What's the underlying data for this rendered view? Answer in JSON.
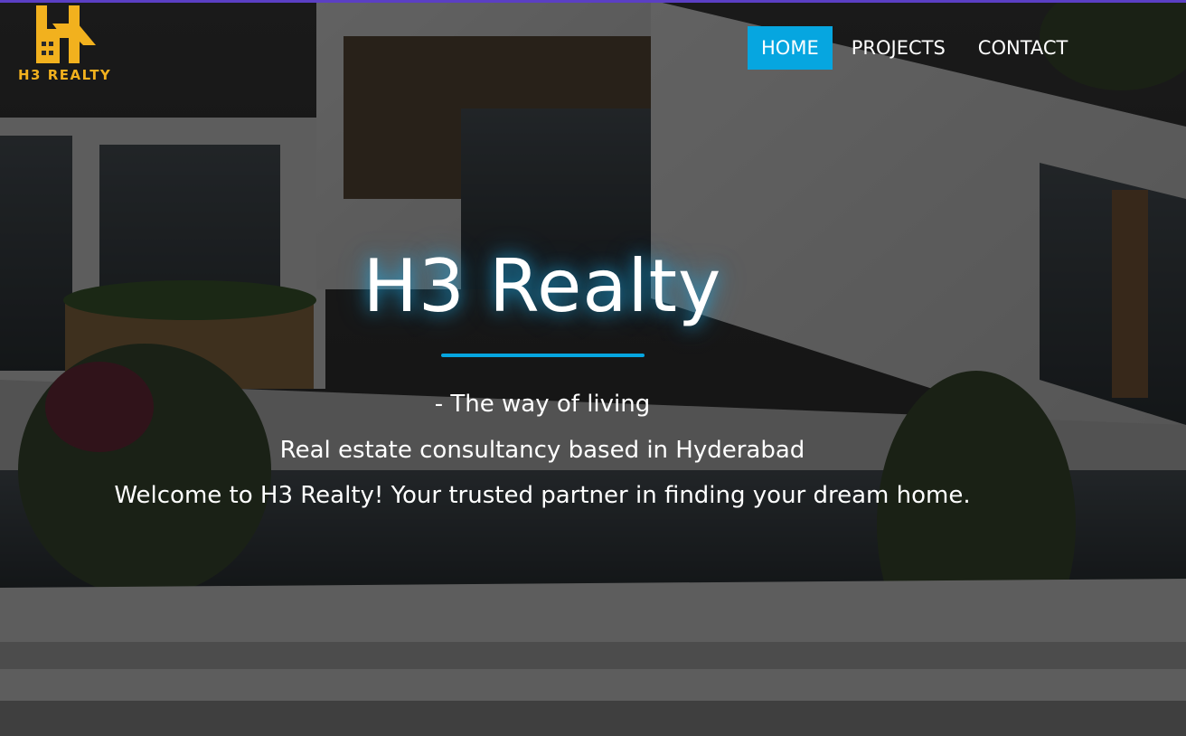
{
  "brand": {
    "logo_text": "H3 REALTY",
    "logo_color": "#f2b11e"
  },
  "nav": {
    "items": [
      {
        "label": "HOME",
        "active": true
      },
      {
        "label": "PROJECTS",
        "active": false
      },
      {
        "label": "CONTACT",
        "active": false
      }
    ],
    "active_color": "#06a6e0"
  },
  "hero": {
    "title": "H3 Realty",
    "tagline": "- The way of living",
    "subtitle": "Real estate consultancy based in Hyderabad",
    "welcome": "Welcome to H3 Realty! Your trusted partner in finding your dream home.",
    "accent_color": "#06a6e0"
  }
}
